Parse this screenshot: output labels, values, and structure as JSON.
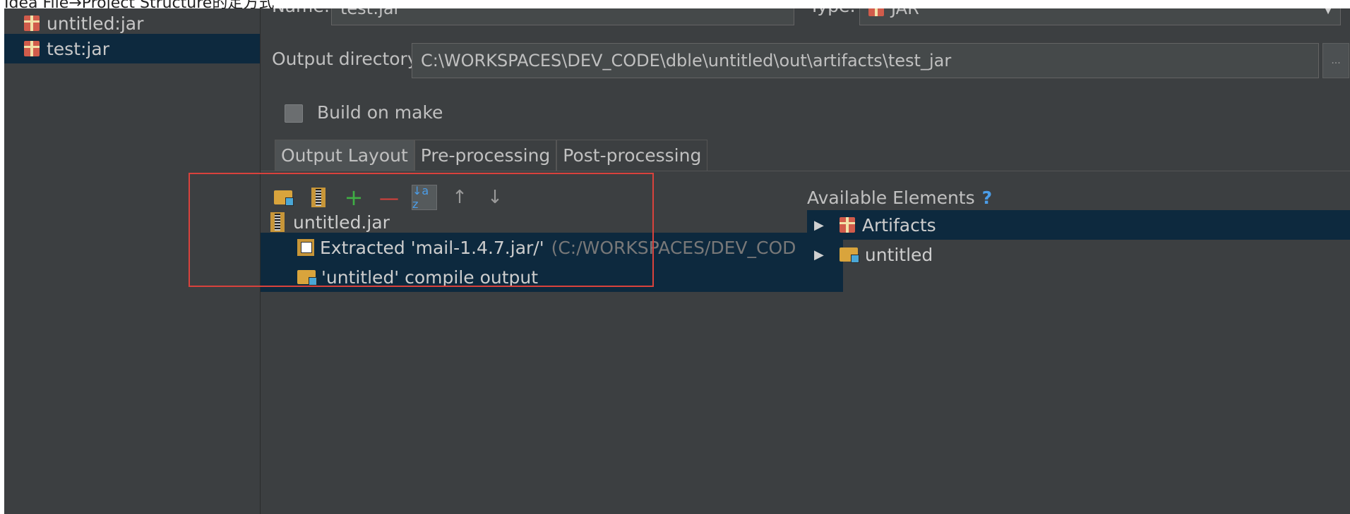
{
  "top_caption": "Idea File→Project Structure的定方式",
  "sidebar": {
    "items": [
      {
        "label": "untitled:jar",
        "selected": false
      },
      {
        "label": "test:jar",
        "selected": true
      }
    ]
  },
  "form": {
    "name_label": "Name:",
    "name_value": "test:jar",
    "type_label": "Type:",
    "type_value": "JAR",
    "output_dir_label": "Output directory:",
    "output_dir_value": "C:\\WORKSPACES\\DEV_CODE\\dble\\untitled\\out\\artifacts\\test_jar",
    "browse_label": "...",
    "build_on_make_label": "Build on make",
    "build_on_make_checked": false
  },
  "tabs": [
    {
      "label": "Output Layout",
      "active": true
    },
    {
      "label": "Pre-processing",
      "active": false
    },
    {
      "label": "Post-processing",
      "active": false
    }
  ],
  "toolbar": {
    "icons": [
      "new-folder-icon",
      "jar-icon",
      "add-icon",
      "remove-icon",
      "sort-az-icon",
      "move-up-icon",
      "move-down-icon"
    ],
    "add_glyph": "+",
    "remove_glyph": "—",
    "sort_glyph": "↓a z",
    "up_glyph": "↑",
    "down_glyph": "↓"
  },
  "layout_tree": {
    "root": "untitled.jar",
    "children": [
      {
        "label": "Extracted 'mail-1.4.7.jar/'",
        "detail": "(C:/WORKSPACES/DEV_COD",
        "icon": "extract-icon"
      },
      {
        "label": "'untitled' compile output",
        "icon": "module-folder-icon"
      }
    ]
  },
  "available": {
    "title": "Available Elements",
    "help": "?",
    "items": [
      {
        "label": "Artifacts",
        "icon": "gift-icon",
        "selected": true
      },
      {
        "label": "untitled",
        "icon": "module-folder-icon",
        "selected": false
      }
    ],
    "arrow": "▶"
  },
  "colors": {
    "background": "#3c3f41",
    "selection": "#0d293e",
    "highlight_box": "#d9423c",
    "help": "#4b9de8"
  }
}
